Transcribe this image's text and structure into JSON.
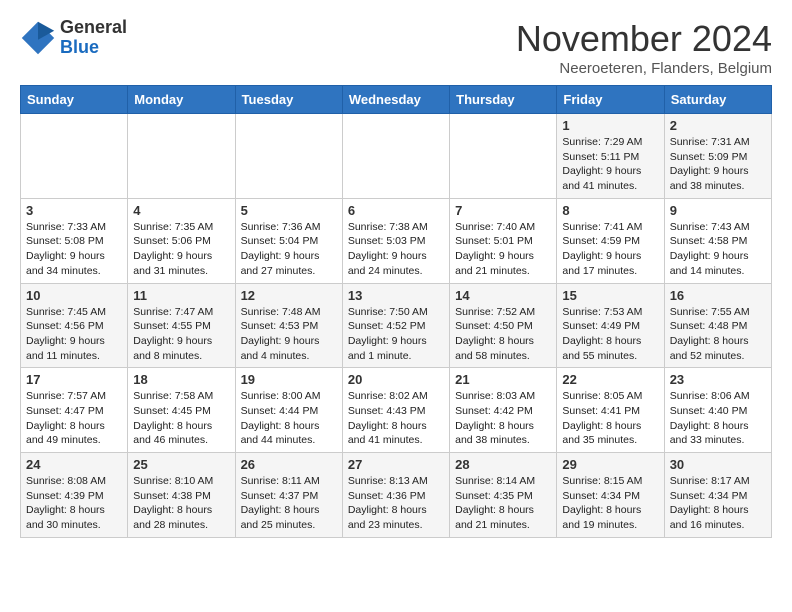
{
  "header": {
    "logo_general": "General",
    "logo_blue": "Blue",
    "month_title": "November 2024",
    "location": "Neeroeteren, Flanders, Belgium"
  },
  "days_of_week": [
    "Sunday",
    "Monday",
    "Tuesday",
    "Wednesday",
    "Thursday",
    "Friday",
    "Saturday"
  ],
  "weeks": [
    [
      {
        "day": "",
        "info": ""
      },
      {
        "day": "",
        "info": ""
      },
      {
        "day": "",
        "info": ""
      },
      {
        "day": "",
        "info": ""
      },
      {
        "day": "",
        "info": ""
      },
      {
        "day": "1",
        "info": "Sunrise: 7:29 AM\nSunset: 5:11 PM\nDaylight: 9 hours and 41 minutes."
      },
      {
        "day": "2",
        "info": "Sunrise: 7:31 AM\nSunset: 5:09 PM\nDaylight: 9 hours and 38 minutes."
      }
    ],
    [
      {
        "day": "3",
        "info": "Sunrise: 7:33 AM\nSunset: 5:08 PM\nDaylight: 9 hours and 34 minutes."
      },
      {
        "day": "4",
        "info": "Sunrise: 7:35 AM\nSunset: 5:06 PM\nDaylight: 9 hours and 31 minutes."
      },
      {
        "day": "5",
        "info": "Sunrise: 7:36 AM\nSunset: 5:04 PM\nDaylight: 9 hours and 27 minutes."
      },
      {
        "day": "6",
        "info": "Sunrise: 7:38 AM\nSunset: 5:03 PM\nDaylight: 9 hours and 24 minutes."
      },
      {
        "day": "7",
        "info": "Sunrise: 7:40 AM\nSunset: 5:01 PM\nDaylight: 9 hours and 21 minutes."
      },
      {
        "day": "8",
        "info": "Sunrise: 7:41 AM\nSunset: 4:59 PM\nDaylight: 9 hours and 17 minutes."
      },
      {
        "day": "9",
        "info": "Sunrise: 7:43 AM\nSunset: 4:58 PM\nDaylight: 9 hours and 14 minutes."
      }
    ],
    [
      {
        "day": "10",
        "info": "Sunrise: 7:45 AM\nSunset: 4:56 PM\nDaylight: 9 hours and 11 minutes."
      },
      {
        "day": "11",
        "info": "Sunrise: 7:47 AM\nSunset: 4:55 PM\nDaylight: 9 hours and 8 minutes."
      },
      {
        "day": "12",
        "info": "Sunrise: 7:48 AM\nSunset: 4:53 PM\nDaylight: 9 hours and 4 minutes."
      },
      {
        "day": "13",
        "info": "Sunrise: 7:50 AM\nSunset: 4:52 PM\nDaylight: 9 hours and 1 minute."
      },
      {
        "day": "14",
        "info": "Sunrise: 7:52 AM\nSunset: 4:50 PM\nDaylight: 8 hours and 58 minutes."
      },
      {
        "day": "15",
        "info": "Sunrise: 7:53 AM\nSunset: 4:49 PM\nDaylight: 8 hours and 55 minutes."
      },
      {
        "day": "16",
        "info": "Sunrise: 7:55 AM\nSunset: 4:48 PM\nDaylight: 8 hours and 52 minutes."
      }
    ],
    [
      {
        "day": "17",
        "info": "Sunrise: 7:57 AM\nSunset: 4:47 PM\nDaylight: 8 hours and 49 minutes."
      },
      {
        "day": "18",
        "info": "Sunrise: 7:58 AM\nSunset: 4:45 PM\nDaylight: 8 hours and 46 minutes."
      },
      {
        "day": "19",
        "info": "Sunrise: 8:00 AM\nSunset: 4:44 PM\nDaylight: 8 hours and 44 minutes."
      },
      {
        "day": "20",
        "info": "Sunrise: 8:02 AM\nSunset: 4:43 PM\nDaylight: 8 hours and 41 minutes."
      },
      {
        "day": "21",
        "info": "Sunrise: 8:03 AM\nSunset: 4:42 PM\nDaylight: 8 hours and 38 minutes."
      },
      {
        "day": "22",
        "info": "Sunrise: 8:05 AM\nSunset: 4:41 PM\nDaylight: 8 hours and 35 minutes."
      },
      {
        "day": "23",
        "info": "Sunrise: 8:06 AM\nSunset: 4:40 PM\nDaylight: 8 hours and 33 minutes."
      }
    ],
    [
      {
        "day": "24",
        "info": "Sunrise: 8:08 AM\nSunset: 4:39 PM\nDaylight: 8 hours and 30 minutes."
      },
      {
        "day": "25",
        "info": "Sunrise: 8:10 AM\nSunset: 4:38 PM\nDaylight: 8 hours and 28 minutes."
      },
      {
        "day": "26",
        "info": "Sunrise: 8:11 AM\nSunset: 4:37 PM\nDaylight: 8 hours and 25 minutes."
      },
      {
        "day": "27",
        "info": "Sunrise: 8:13 AM\nSunset: 4:36 PM\nDaylight: 8 hours and 23 minutes."
      },
      {
        "day": "28",
        "info": "Sunrise: 8:14 AM\nSunset: 4:35 PM\nDaylight: 8 hours and 21 minutes."
      },
      {
        "day": "29",
        "info": "Sunrise: 8:15 AM\nSunset: 4:34 PM\nDaylight: 8 hours and 19 minutes."
      },
      {
        "day": "30",
        "info": "Sunrise: 8:17 AM\nSunset: 4:34 PM\nDaylight: 8 hours and 16 minutes."
      }
    ]
  ]
}
